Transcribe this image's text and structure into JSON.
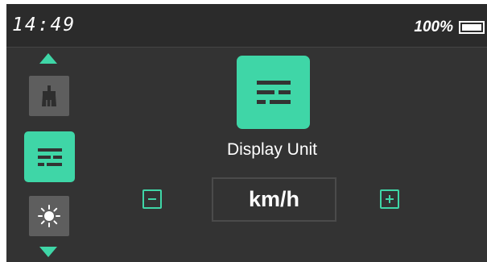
{
  "status_bar": {
    "time": "14:49",
    "battery_text": "100%",
    "battery_level": 1.0
  },
  "sidebar": {
    "items": [
      {
        "icon": "brush-icon",
        "state": "inactive"
      },
      {
        "icon": "display-unit-icon",
        "state": "selected"
      },
      {
        "icon": "brightness-icon",
        "state": "inactive"
      }
    ],
    "up_icon": "arrow-up-icon",
    "down_icon": "arrow-down-icon"
  },
  "setting": {
    "icon": "display-unit-icon",
    "label": "Display Unit",
    "value": "km/h",
    "decrease_icon": "minus-icon",
    "increase_icon": "plus-icon"
  },
  "colors": {
    "accent": "#3fd6a7",
    "background": "#333333",
    "status_bar": "#2b2b2b",
    "inactive_tile": "#5e5e5e",
    "text": "#ffffff"
  }
}
